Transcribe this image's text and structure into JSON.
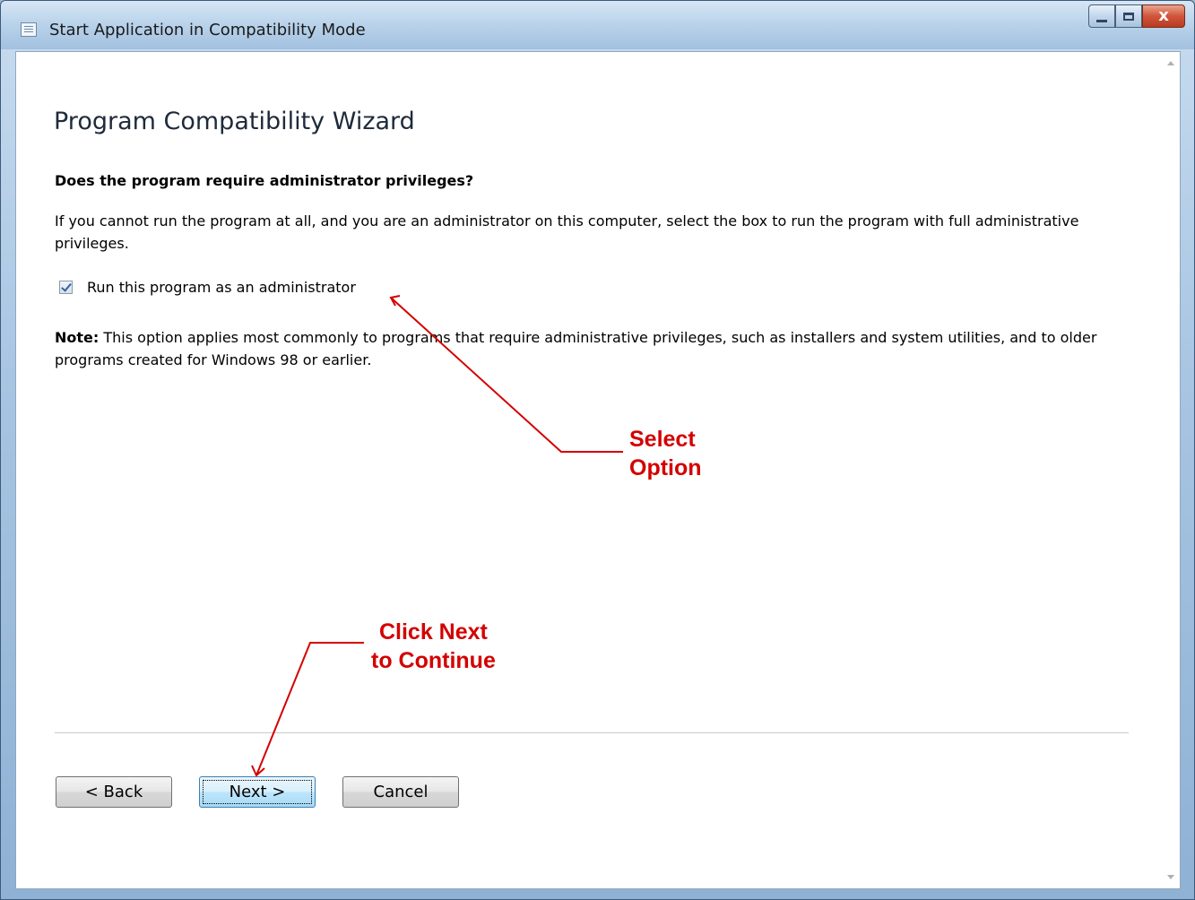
{
  "window": {
    "title": "Start Application in Compatibility Mode",
    "close_glyph": "x"
  },
  "wizard": {
    "heading": "Program Compatibility Wizard",
    "question": "Does the program require administrator privileges?",
    "description": "If you cannot run the program at all, and you are an administrator on this computer, select the box to run the program with full administrative privileges.",
    "checkbox": {
      "label": "Run this program as an administrator",
      "checked": true
    },
    "note_label": "Note:",
    "note_text": " This option applies most commonly to programs that require administrative privileges, such as installers and system utilities, and to older programs created for Windows 98 or earlier."
  },
  "buttons": {
    "back": "< Back",
    "next": "Next >",
    "cancel": "Cancel"
  },
  "annotations": {
    "select_option_line1": "Select",
    "select_option_line2": "Option",
    "click_next_line1": "Click Next",
    "click_next_line2": "to Continue",
    "color": "#d40000"
  },
  "icons": {
    "title_icon": "window-app-icon",
    "minimize": "minimize-icon",
    "maximize": "maximize-icon",
    "close": "close-icon"
  }
}
